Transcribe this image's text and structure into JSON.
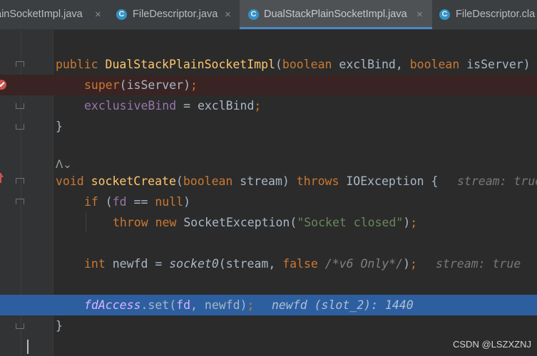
{
  "tabs": [
    {
      "label": "ainSocketImpl.java",
      "icon": "none",
      "active": false
    },
    {
      "label": "FileDescriptor.java",
      "icon": "java-class-icon",
      "active": false
    },
    {
      "label": "DualStackPlainSocketImpl.java",
      "icon": "java-class-icon",
      "active": true
    },
    {
      "label": "FileDescriptor.cla",
      "icon": "java-class-icon",
      "active": false
    }
  ],
  "tab_icon_letter": "C",
  "close_glyph": "×",
  "code": {
    "ctor_public": "public ",
    "ctor_name": "DualStackPlainSocketImpl",
    "ctor_params_open": "(",
    "ctor_kw_boolean1": "boolean",
    "ctor_p1": " exclBind, ",
    "ctor_kw_boolean2": "boolean",
    "ctor_p2": " isServer)",
    "super_kw": "super",
    "super_args": "(isServer)",
    "semicolon": ";",
    "excl_field": "exclusiveBind",
    "excl_assign": " = exclBind",
    "close_brace": "}",
    "void_kw": "void ",
    "method_name": "socketCreate",
    "m_open": "(",
    "m_boolean": "boolean",
    "m_param": " stream) ",
    "throws_kw": "throws",
    "m_exception": " IOException {",
    "hint_stream": "stream: true",
    "if_kw": "if",
    "if_open": " (",
    "fd_field": "fd",
    "if_eq": " == ",
    "null_kw": "null",
    "if_close": ")",
    "throw_kw": "throw ",
    "new_kw": "new ",
    "sock_exc": "SocketException(",
    "sock_msg": "\"Socket closed\"",
    "sock_end": ")",
    "int_kw": "int ",
    "newfd_assign": "newfd = ",
    "socket0": "socket0",
    "s0_args": "(stream, ",
    "false_kw": "false",
    "space": " ",
    "v6_comment": "/*v6 Only*/",
    "s0_end": ")",
    "hint_stream2": "stream: true",
    "fdaccess": "fdAccess",
    "set_call": ".set(",
    "fd2": "fd",
    "set_args": ", newfd)",
    "hint_newfd": "newfd (slot_2): 1440"
  },
  "watermark": "CSDN @LSZXZNJ",
  "colors": {
    "keyword": "#cc7832",
    "method_decl": "#ffc66d",
    "field": "#9876aa",
    "string": "#6a8759",
    "execution_line": "#2d5fa0",
    "breakpoint_line": "#3a2323"
  }
}
